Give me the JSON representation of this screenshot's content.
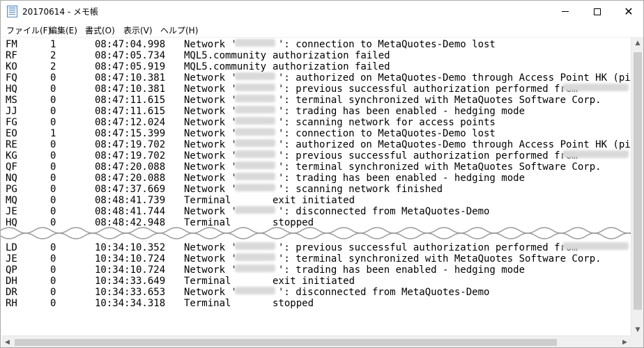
{
  "window": {
    "title": "20170614 - メモ帳",
    "minimize_icon": "minimize-icon",
    "maximize_icon": "maximize-icon",
    "close_icon": "close-icon",
    "close_glyph": "✕"
  },
  "menu": [
    {
      "label": "ファイル(F)"
    },
    {
      "label": "編集(E)"
    },
    {
      "label": "書式(O)"
    },
    {
      "label": "表示(V)"
    },
    {
      "label": "ヘルプ(H)"
    }
  ],
  "log_lines_top": [
    {
      "id": "FM",
      "level": "1",
      "time": "08:47:04.998",
      "source": "Network '",
      "redacted": true,
      "message": "': connection to MetaQuotes-Demo lost"
    },
    {
      "id": "RF",
      "level": "2",
      "time": "08:47:05.734",
      "source": "MQL5.community",
      "redacted": false,
      "message": "authorization failed"
    },
    {
      "id": "KO",
      "level": "2",
      "time": "08:47:05.919",
      "source": "MQL5.community",
      "redacted": false,
      "message": "authorization failed"
    },
    {
      "id": "FQ",
      "level": "0",
      "time": "08:47:10.381",
      "source": "Network '",
      "redacted": true,
      "message": "': authorized on MetaQuotes-Demo through Access Point HK (ping:"
    },
    {
      "id": "HQ",
      "level": "0",
      "time": "08:47:10.381",
      "source": "Network '",
      "redacted": true,
      "message": "': previous successful authorization performed from"
    },
    {
      "id": "MS",
      "level": "0",
      "time": "08:47:11.615",
      "source": "Network '",
      "redacted": true,
      "message": "': terminal synchronized with MetaQuotes Software Corp."
    },
    {
      "id": "JJ",
      "level": "0",
      "time": "08:47:11.615",
      "source": "Network '",
      "redacted": true,
      "message": "': trading has been enabled - hedging mode"
    },
    {
      "id": "FG",
      "level": "0",
      "time": "08:47:12.024",
      "source": "Network '",
      "redacted": true,
      "message": "': scanning network for access points"
    },
    {
      "id": "EO",
      "level": "1",
      "time": "08:47:15.399",
      "source": "Network '",
      "redacted": true,
      "message": "': connection to MetaQuotes-Demo lost"
    },
    {
      "id": "RE",
      "level": "0",
      "time": "08:47:19.702",
      "source": "Network '",
      "redacted": true,
      "message": "': authorized on MetaQuotes-Demo through Access Point HK (ping:"
    },
    {
      "id": "KG",
      "level": "0",
      "time": "08:47:19.702",
      "source": "Network '",
      "redacted": true,
      "message": "': previous successful authorization performed from"
    },
    {
      "id": "QF",
      "level": "0",
      "time": "08:47:20.088",
      "source": "Network '",
      "redacted": true,
      "message": "': terminal synchronized with MetaQuotes Software Corp."
    },
    {
      "id": "NQ",
      "level": "0",
      "time": "08:47:20.088",
      "source": "Network '",
      "redacted": true,
      "message": "': trading has been enabled - hedging mode"
    },
    {
      "id": "PG",
      "level": "0",
      "time": "08:47:37.669",
      "source": "Network '",
      "redacted": true,
      "message": "': scanning network finished"
    },
    {
      "id": "MQ",
      "level": "0",
      "time": "08:48:41.739",
      "source": "Terminal",
      "redacted": false,
      "message": "exit initiated"
    },
    {
      "id": "JE",
      "level": "0",
      "time": "08:48:41.744",
      "source": "Network '",
      "redacted": true,
      "message": "': disconnected from MetaQuotes-Demo"
    },
    {
      "id": "HQ",
      "level": "0",
      "time": "08:48:42.948",
      "source": "Terminal",
      "redacted": false,
      "message": "stopped"
    }
  ],
  "log_lines_bottom": [
    {
      "id": "LD",
      "level": "0",
      "time": "10:34:10.352",
      "source": "Network '",
      "redacted": true,
      "message": "': previous successful authorization performed from"
    },
    {
      "id": "JE",
      "level": "0",
      "time": "10:34:10.724",
      "source": "Network '",
      "redacted": true,
      "message": "': terminal synchronized with MetaQuotes Software Corp."
    },
    {
      "id": "QP",
      "level": "0",
      "time": "10:34:10.724",
      "source": "Network '",
      "redacted": true,
      "message": "': trading has been enabled - hedging mode"
    },
    {
      "id": "DH",
      "level": "0",
      "time": "10:34:33.649",
      "source": "Terminal",
      "redacted": false,
      "message": "exit initiated"
    },
    {
      "id": "DR",
      "level": "0",
      "time": "10:34:33.653",
      "source": "Network '",
      "redacted": true,
      "message": "': disconnected from MetaQuotes-Demo"
    },
    {
      "id": "RH",
      "level": "0",
      "time": "10:34:34.318",
      "source": "Terminal",
      "redacted": false,
      "message": "stopped"
    }
  ],
  "scrollbars": {
    "up_arrow": "▲",
    "down_arrow": "▼",
    "left_arrow": "◀",
    "right_arrow": "▶"
  }
}
